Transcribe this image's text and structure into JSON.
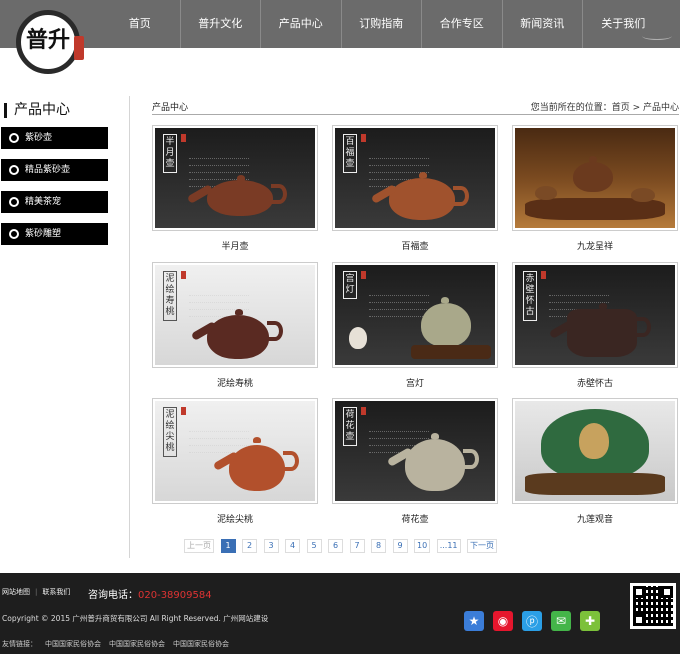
{
  "logo": {
    "char": "普升"
  },
  "nav": [
    "首页",
    "普升文化",
    "产品中心",
    "订购指南",
    "合作专区",
    "新闻资讯",
    "关于我们"
  ],
  "sidebar": {
    "title": "产品中心",
    "items": [
      {
        "label": "紫砂壶"
      },
      {
        "label": "精品紫砂壶"
      },
      {
        "label": "精美茶宠"
      },
      {
        "label": "紫砂雕塑"
      }
    ]
  },
  "breadcrumb": {
    "title": "产品中心",
    "location": "您当前所在的位置：首页 > 产品中心"
  },
  "products": [
    {
      "name": "半月壶",
      "tag": "半月壶"
    },
    {
      "name": "百福壶",
      "tag": "百福壶"
    },
    {
      "name": "九龙呈祥",
      "tag": ""
    },
    {
      "name": "泥绘寿桃",
      "tag": "泥绘寿桃"
    },
    {
      "name": "宫灯",
      "tag": "宫灯"
    },
    {
      "name": "赤壁怀古",
      "tag": "赤壁怀古"
    },
    {
      "name": "泥绘尖桃",
      "tag": "泥绘尖桃"
    },
    {
      "name": "荷花壶",
      "tag": "荷花壶"
    },
    {
      "name": "九莲观音",
      "tag": ""
    }
  ],
  "pagination": {
    "prev": "上一页",
    "pages": [
      "1",
      "2",
      "3",
      "4",
      "5",
      "6",
      "7",
      "8",
      "9",
      "10"
    ],
    "current": "1",
    "ellipsis": "...11",
    "next": "下一页"
  },
  "footer": {
    "links": [
      "网站地图",
      "联系我们"
    ],
    "hotline_label": "咨询电话：",
    "hotline_number": "020-38909584",
    "copyright": "Copyright © 2015 广州普升商贸有限公司 All Right Reserved. 广州网站建设",
    "friend_label": "友情链接：",
    "friend_links": [
      "中国国家民俗协会",
      "中国国家民俗协会",
      "中国国家民俗协会"
    ]
  },
  "colors": {
    "nav_bg": "#6b6b6b",
    "accent": "#3a6fb5",
    "hotline": "#dd3333",
    "footer_bg": "#1e1e1e"
  }
}
